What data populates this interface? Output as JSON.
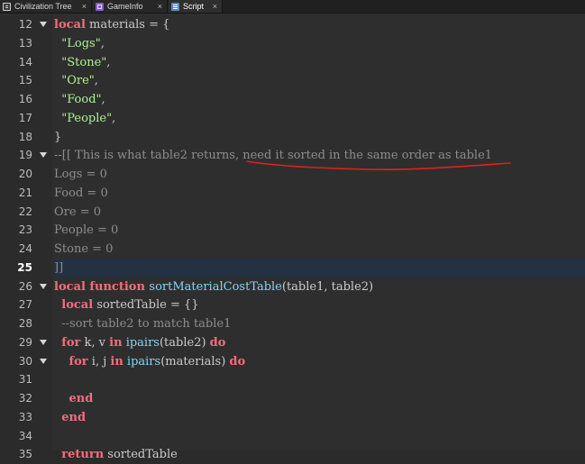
{
  "tabs": [
    {
      "label": "Civilization Tree",
      "icon": "script-doc-icon",
      "active": false
    },
    {
      "label": "GameInfo",
      "icon": "module-script-icon",
      "active": false
    },
    {
      "label": "Script",
      "icon": "script-icon",
      "active": true
    }
  ],
  "close_glyph": "×",
  "editor": {
    "current_line": "25",
    "lines": [
      {
        "n": "12",
        "fold": true,
        "tokens": [
          {
            "t": "local",
            "c": "kw"
          },
          {
            "t": " materials = {",
            "c": "pl"
          }
        ]
      },
      {
        "n": "13",
        "fold": false,
        "tokens": [
          {
            "t": "  ",
            "c": "pl"
          },
          {
            "t": "\"Logs\"",
            "c": "str"
          },
          {
            "t": ",",
            "c": "pl"
          }
        ]
      },
      {
        "n": "14",
        "fold": false,
        "tokens": [
          {
            "t": "  ",
            "c": "pl"
          },
          {
            "t": "\"Stone\"",
            "c": "str"
          },
          {
            "t": ",",
            "c": "pl"
          }
        ]
      },
      {
        "n": "15",
        "fold": false,
        "tokens": [
          {
            "t": "  ",
            "c": "pl"
          },
          {
            "t": "\"Ore\"",
            "c": "str"
          },
          {
            "t": ",",
            "c": "pl"
          }
        ]
      },
      {
        "n": "16",
        "fold": false,
        "tokens": [
          {
            "t": "  ",
            "c": "pl"
          },
          {
            "t": "\"Food\"",
            "c": "str"
          },
          {
            "t": ",",
            "c": "pl"
          }
        ]
      },
      {
        "n": "17",
        "fold": false,
        "tokens": [
          {
            "t": "  ",
            "c": "pl"
          },
          {
            "t": "\"People\"",
            "c": "str"
          },
          {
            "t": ",",
            "c": "pl"
          }
        ]
      },
      {
        "n": "18",
        "fold": false,
        "tokens": [
          {
            "t": "}",
            "c": "pl"
          }
        ]
      },
      {
        "n": "19",
        "fold": true,
        "tokens": [
          {
            "t": "--[[ This is what table2 returns, need it sorted in the same order as table1",
            "c": "cm"
          }
        ]
      },
      {
        "n": "20",
        "fold": false,
        "tokens": [
          {
            "t": "Logs = 0",
            "c": "cm"
          }
        ]
      },
      {
        "n": "21",
        "fold": false,
        "tokens": [
          {
            "t": "Food = 0",
            "c": "cm"
          }
        ]
      },
      {
        "n": "22",
        "fold": false,
        "tokens": [
          {
            "t": "Ore = 0",
            "c": "cm"
          }
        ]
      },
      {
        "n": "23",
        "fold": false,
        "tokens": [
          {
            "t": "People = 0",
            "c": "cm"
          }
        ]
      },
      {
        "n": "24",
        "fold": false,
        "tokens": [
          {
            "t": "Stone = 0",
            "c": "cm"
          }
        ]
      },
      {
        "n": "25",
        "fold": false,
        "tokens": [
          {
            "t": "]]",
            "c": "cm"
          }
        ]
      },
      {
        "n": "26",
        "fold": true,
        "tokens": [
          {
            "t": "local function ",
            "c": "kw"
          },
          {
            "t": "sortMaterialCostTable",
            "c": "bi"
          },
          {
            "t": "(table1, table2)",
            "c": "pl"
          }
        ]
      },
      {
        "n": "27",
        "fold": false,
        "tokens": [
          {
            "t": "  ",
            "c": "pl"
          },
          {
            "t": "local",
            "c": "kw"
          },
          {
            "t": " sortedTable = {}",
            "c": "pl"
          }
        ]
      },
      {
        "n": "28",
        "fold": false,
        "tokens": [
          {
            "t": "  ",
            "c": "pl"
          },
          {
            "t": "--sort table2 to match table1",
            "c": "cm"
          }
        ]
      },
      {
        "n": "29",
        "fold": true,
        "tokens": [
          {
            "t": "  ",
            "c": "pl"
          },
          {
            "t": "for",
            "c": "kw"
          },
          {
            "t": " k, v ",
            "c": "pl"
          },
          {
            "t": "in",
            "c": "kw"
          },
          {
            "t": " ",
            "c": "pl"
          },
          {
            "t": "ipairs",
            "c": "bi"
          },
          {
            "t": "(table2) ",
            "c": "pl"
          },
          {
            "t": "do",
            "c": "kw"
          }
        ]
      },
      {
        "n": "30",
        "fold": true,
        "tokens": [
          {
            "t": "    ",
            "c": "pl"
          },
          {
            "t": "for",
            "c": "kw"
          },
          {
            "t": " i, j ",
            "c": "pl"
          },
          {
            "t": "in",
            "c": "kw"
          },
          {
            "t": " ",
            "c": "pl"
          },
          {
            "t": "ipairs",
            "c": "bi"
          },
          {
            "t": "(materials) ",
            "c": "pl"
          },
          {
            "t": "do",
            "c": "kw"
          }
        ]
      },
      {
        "n": "31",
        "fold": false,
        "tokens": []
      },
      {
        "n": "32",
        "fold": false,
        "tokens": [
          {
            "t": "    ",
            "c": "pl"
          },
          {
            "t": "end",
            "c": "kw"
          }
        ]
      },
      {
        "n": "33",
        "fold": false,
        "tokens": [
          {
            "t": "  ",
            "c": "pl"
          },
          {
            "t": "end",
            "c": "kw"
          }
        ]
      },
      {
        "n": "34",
        "fold": false,
        "tokens": []
      },
      {
        "n": "35",
        "fold": false,
        "tokens": [
          {
            "t": "  ",
            "c": "pl"
          },
          {
            "t": "return",
            "c": "kw"
          },
          {
            "t": " sortedTable",
            "c": "pl"
          }
        ]
      }
    ]
  },
  "colors": {
    "background": "#2e2e2e",
    "gutter": "#2b2b2b",
    "keyword": "#f86d7c",
    "string": "#adf195",
    "comment": "#8e8e8e",
    "builtin": "#84d6f7",
    "current_line": "#243142",
    "annotation": "#e02020"
  }
}
